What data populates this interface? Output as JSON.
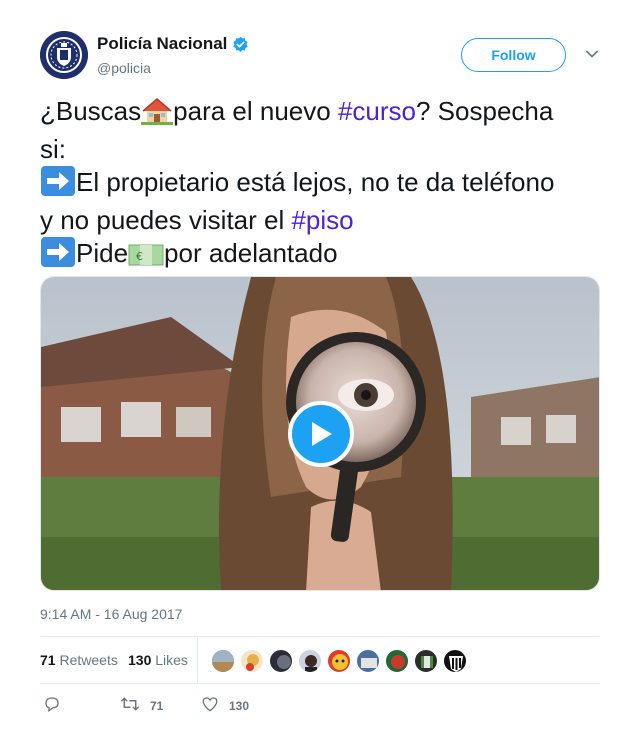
{
  "account": {
    "display_name": "Policía Nacional",
    "handle": "@policia",
    "verified": true,
    "follow_label": "Follow"
  },
  "tweet": {
    "line1_a": "¿Buscas",
    "line1_b": "para el nuevo ",
    "line1_hashtag": "#curso",
    "line1_c": "? Sospecha",
    "line2": "si:",
    "line3": "El propietario está lejos, no te da teléfono",
    "line4_a": "y no puedes visitar el ",
    "line4_hashtag": "#piso",
    "line5_a": "Pide",
    "line5_b": "por adelantado"
  },
  "emojis": {
    "house": "house-icon",
    "arrow": "right-arrow-icon",
    "money": "banknote-icon"
  },
  "media": {
    "type": "video-gif",
    "play_icon": "play-icon"
  },
  "timestamp": "9:14 AM - 16 Aug 2017",
  "stats": {
    "retweets_count": "71",
    "retweets_label": "Retweets",
    "likes_count": "130",
    "likes_label": "Likes"
  },
  "actions": {
    "reply_icon": "reply-icon",
    "retweet_icon": "retweet-icon",
    "retweet_count": "71",
    "like_icon": "heart-icon",
    "like_count": "130"
  },
  "colors": {
    "accent": "#1da1f2",
    "hashtag": "#4b23d9",
    "text": "#14171a",
    "muted": "#657786",
    "border": "#e6ecf0"
  }
}
